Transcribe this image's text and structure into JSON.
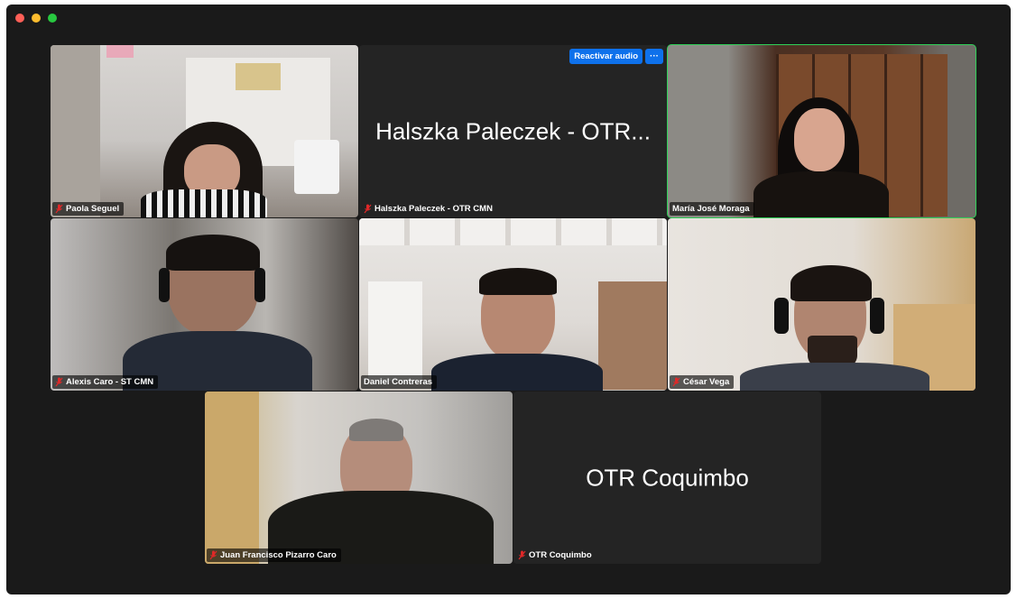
{
  "participants": [
    {
      "name": "Paola Seguel",
      "muted": true
    },
    {
      "name": "Halszka Paleczek - OTR CMN",
      "display_name": "Halszka Paleczek - OTR...",
      "muted": true
    },
    {
      "name": "María José Moraga",
      "muted": false,
      "active_speaker": true
    },
    {
      "name": "Alexis Caro - ST CMN",
      "muted": true
    },
    {
      "name": "Daniel Contreras",
      "muted": false
    },
    {
      "name": "César Vega",
      "muted": true
    },
    {
      "name": "Juan Francisco Pizarro Caro",
      "muted": true
    },
    {
      "name": "OTR Coquimbo",
      "display_name": "OTR Coquimbo",
      "muted": true
    }
  ],
  "controls": {
    "unmute_label": "Reactivar audio",
    "more_label": "···"
  },
  "colors": {
    "background": "#1a1a1a",
    "tile": "#242424",
    "active_border": "#2fd158",
    "accent": "#0e71eb",
    "muted_icon": "#e02828"
  }
}
